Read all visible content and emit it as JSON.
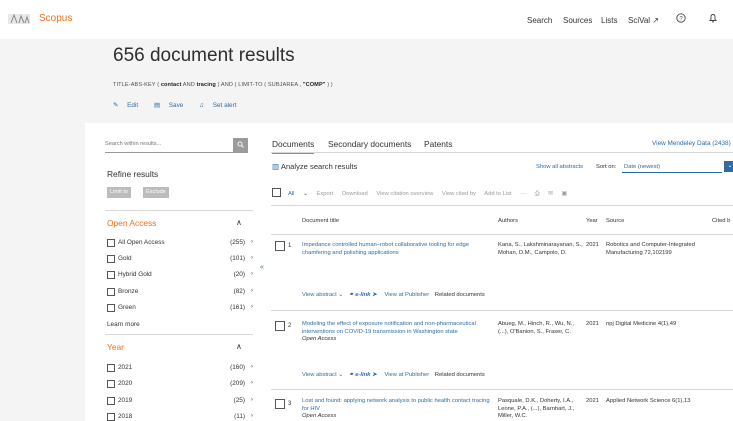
{
  "header": {
    "brand": "Scopus",
    "nav": [
      "Search",
      "Sources",
      "Lists",
      "SciVal ↗"
    ],
    "help_icon": "help-circle-icon",
    "bell_icon": "bell-icon"
  },
  "colors": {
    "accent": "#e9711c",
    "link": "#2e6da4",
    "panel_bg": "#f4f4f4"
  },
  "results_header": {
    "title": "656 document results",
    "query": {
      "prefix": "TITLE-ABS-KEY (",
      "t1": "contact",
      "and": "AND",
      "t2": "tracing",
      "mid": ") AND ( LIMIT-TO ( SUBJAREA ,",
      "t3": "\"COMP\"",
      "suffix": ") )"
    },
    "actions": {
      "edit": "Edit",
      "save": "Save",
      "set_alert": "Set alert"
    }
  },
  "filters": {
    "search_placeholder": "Search within results...",
    "refine_label": "Refine results",
    "limit_to": "Limit to",
    "exclude": "Exclude",
    "open_access": {
      "heading": "Open Access",
      "items": [
        {
          "label": "All Open Access",
          "count": "(255)"
        },
        {
          "label": "Gold",
          "count": "(101)"
        },
        {
          "label": "Hybrid Gold",
          "count": "(20)"
        },
        {
          "label": "Bronze",
          "count": "(82)"
        },
        {
          "label": "Green",
          "count": "(161)"
        }
      ],
      "learn_more": "Learn more"
    },
    "year": {
      "heading": "Year",
      "items": [
        {
          "label": "2021",
          "count": "(160)"
        },
        {
          "label": "2020",
          "count": "(209)"
        },
        {
          "label": "2019",
          "count": "(25)"
        },
        {
          "label": "2018",
          "count": "(11)"
        }
      ]
    }
  },
  "tabs": {
    "documents": "Documents",
    "secondary": "Secondary documents",
    "patents": "Patents",
    "mendeley": "View Mendeley Data (2438)"
  },
  "analyze": {
    "label": "Analyze search results",
    "show_all_abstracts": "Show all abstracts",
    "sort_on": "Sort on:",
    "sort_value": "Date (newest)"
  },
  "toolbar": {
    "all": "All",
    "export": "Export",
    "download": "Download",
    "view_citation": "View citation overview",
    "view_cited_by": "View cited by",
    "add_to_list": "Add to List",
    "more": "···"
  },
  "columns": {
    "title": "Document title",
    "authors": "Authors",
    "year": "Year",
    "source": "Source",
    "cited_by": "Cited b"
  },
  "rows": [
    {
      "num": "1",
      "title": "Impedance controlled human–robot collaborative tooling for edge chamfering and polishing applications",
      "oa": "",
      "authors": "Kana, S., Lakshminarayanan, S., Mohan, D.M., Campolo, D.",
      "year": "2021",
      "source": "Robotics and Computer-Integrated Manufacturing 72,102199"
    },
    {
      "num": "2",
      "title": "Modeling the effect of exposure notification and non-pharmaceutical interventions on COVID-19 transmission in Washington state",
      "oa": "Open Access",
      "authors": "Abueg, M., Hinch, R., Wu, N., (...), O'Banion, S., Fraser, C.",
      "year": "2021",
      "source": "npj Digital Medicine 4(1),49"
    },
    {
      "num": "3",
      "title": "Lost and found: applying network analysis to public health contact tracing for HIV",
      "oa": "Open Access",
      "authors": "Pasquale, D.K., Doherty, I.A., Leone, P.A., (...), Barnhart, J., Miller, W.C.",
      "year": "2021",
      "source": "Applied Network Science 6(1),13"
    }
  ],
  "row_actions": {
    "view_abstract": "View abstract ⌄",
    "elink": "e-link",
    "view_publisher": "View at Publisher",
    "related": "Related documents"
  }
}
